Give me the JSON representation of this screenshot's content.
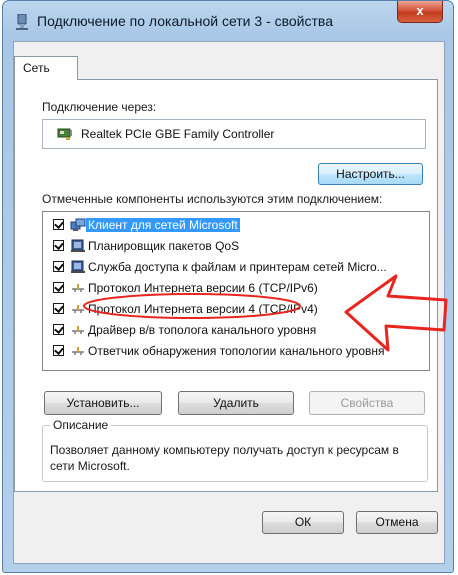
{
  "window": {
    "title": "Подключение по локальной сети 3 - свойства",
    "close_label": "x"
  },
  "tabs": [
    {
      "label": "Сеть",
      "active": true
    }
  ],
  "connection": {
    "label": "Подключение через:",
    "adapter_name": "Realtek PCIe GBE Family Controller",
    "configure_button": "Настроить..."
  },
  "components": {
    "label": "Отмеченные компоненты используются этим подключением:",
    "items": [
      {
        "label": "Клиент для сетей Microsoft",
        "checked": true,
        "selected": true,
        "icon": "network-client-icon"
      },
      {
        "label": "Планировщик пакетов QoS",
        "checked": true,
        "selected": false,
        "icon": "service-icon"
      },
      {
        "label": "Служба доступа к файлам и принтерам сетей Micro...",
        "checked": true,
        "selected": false,
        "icon": "service-icon"
      },
      {
        "label": "Протокол Интернета версии 6 (TCP/IPv6)",
        "checked": true,
        "selected": false,
        "icon": "protocol-icon"
      },
      {
        "label": "Протокол Интернета версии 4 (TCP/IPv4)",
        "checked": true,
        "selected": false,
        "icon": "protocol-icon"
      },
      {
        "label": "Драйвер в/в тополога канального уровня",
        "checked": true,
        "selected": false,
        "icon": "protocol-icon"
      },
      {
        "label": "Ответчик обнаружения топологии канального уровня",
        "checked": true,
        "selected": false,
        "icon": "protocol-icon"
      }
    ]
  },
  "buttons": {
    "install": "Установить...",
    "remove": "Удалить",
    "properties": "Свойства",
    "ok": "ОК",
    "cancel": "Отмена"
  },
  "description": {
    "title": "Описание",
    "text": "Позволяет данному компьютеру получать доступ к ресурсам в сети Microsoft."
  },
  "annotation": {
    "color": "#e8251f"
  }
}
